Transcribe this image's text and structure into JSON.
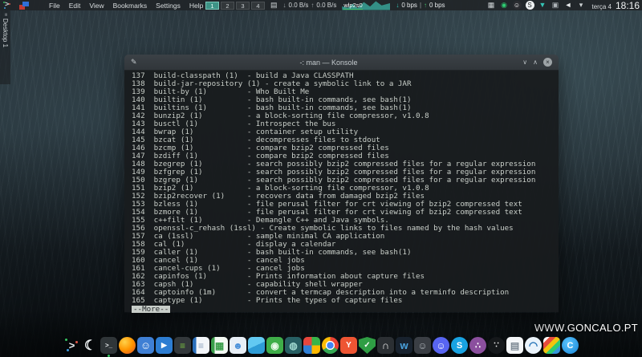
{
  "colors": {
    "panel_bg": "#212528",
    "accent_teal": "#35c4b5",
    "accent_green": "#46c06a",
    "terminal_bg": "#181b1d",
    "terminal_fg": "#c9cfc9",
    "titlebar_bg": "#343a3f",
    "workspace_active_bg": "#3d9386"
  },
  "top_bar": {
    "menus": [
      "File",
      "Edit",
      "View",
      "Bookmarks",
      "Settings",
      "Help"
    ],
    "workspaces": {
      "items": [
        "1",
        "2",
        "3",
        "4"
      ],
      "active": "1"
    },
    "icons": {
      "notes": "▤",
      "grip": "≡"
    },
    "net_speed": {
      "down_arrow": "↓",
      "down": "0.0 B/s",
      "up_arrow": "↑",
      "up": "0.0 B/s"
    },
    "interface": {
      "name": "wlp2s0",
      "down_arrow": "↓",
      "down": "0 bps",
      "separator": "|",
      "up_arrow": "↑",
      "up": "0 bps"
    },
    "tray": [
      {
        "name": "panel-tray-icon",
        "glyph": "▦",
        "fg": "#cfd4d6"
      },
      {
        "name": "status-green-tray-icon",
        "glyph": "◉",
        "fg": "#2ecc71"
      },
      {
        "name": "discord-tray-icon",
        "glyph": "☺",
        "fg": "#ffffff",
        "bg": "#2b2d31",
        "shape": "circle"
      },
      {
        "name": "skype-tray-icon",
        "glyph": "S",
        "fg": "#202325",
        "bg": "#eef1f2",
        "shape": "circle"
      },
      {
        "name": "vpn-tray-icon",
        "glyph": "▼",
        "fg": "#35c4b5"
      },
      {
        "name": "window-tray-icon",
        "glyph": "▣",
        "fg": "#aeb4b8"
      },
      {
        "name": "volume-tray-icon",
        "glyph": "◄",
        "fg": "#e8ebed"
      },
      {
        "name": "caret-down-icon",
        "glyph": "▾",
        "fg": "#cfd4d6"
      }
    ],
    "clock": {
      "date": "terça 4",
      "time": "18:16"
    }
  },
  "pager_label": "Desktop 1",
  "window": {
    "title": "-: man — Konsole",
    "icons": {
      "pin": "✎",
      "minimize": "∨",
      "maximize": "∧",
      "close": "×"
    },
    "terminal_lines": [
      "137  build-classpath (1)  - build a Java CLASSPATH",
      "138  build-jar-repository (1) - create a symbolic link to a JAR",
      "139  built-by (1)         - Who Built Me",
      "140  builtin (1)          - bash built-in commands, see bash(1)",
      "141  builtins (1)         - bash built-in commands, see bash(1)",
      "142  bunzip2 (1)          - a block-sorting file compressor, v1.0.8",
      "143  busctl (1)           - Introspect the bus",
      "144  bwrap (1)            - container setup utility",
      "145  bzcat (1)            - decompresses files to stdout",
      "146  bzcmp (1)            - compare bzip2 compressed files",
      "147  bzdiff (1)           - compare bzip2 compressed files",
      "148  bzegrep (1)          - search possibly bzip2 compressed files for a regular expression",
      "149  bzfgrep (1)          - search possibly bzip2 compressed files for a regular expression",
      "150  bzgrep (1)           - search possibly bzip2 compressed files for a regular expression",
      "151  bzip2 (1)            - a block-sorting file compressor, v1.0.8",
      "152  bzip2recover (1)     - recovers data from damaged bzip2 files",
      "153  bzless (1)           - file perusal filter for crt viewing of bzip2 compressed text",
      "154  bzmore (1)           - file perusal filter for crt viewing of bzip2 compressed text",
      "155  c++filt (1)          - Demangle C++ and Java symbols.",
      "156  openssl-c_rehash (1ssl) - Create symbolic links to files named by the hash values",
      "157  ca (1ssl)            - sample minimal CA application",
      "158  cal (1)              - display a calendar",
      "159  caller (1)           - bash built-in commands, see bash(1)",
      "160  cancel (1)           - cancel jobs",
      "161  cancel-cups (1)      - cancel jobs",
      "162  capinfos (1)         - Prints information about capture files",
      "163  capsh (1)            - capability shell wrapper",
      "164  captoinfo (1m)       - convert a termcap description into a terminfo description",
      "165  captype (1)          - Prints the types of capture files"
    ],
    "more_prompt": "--More--"
  },
  "watermark": "WWW.GONCALO.PT",
  "dock": {
    "items": [
      {
        "name": "distro-logo-icon",
        "type": "logo"
      },
      {
        "name": "night-mode-icon",
        "glyph": "☾",
        "fg": "#eef2f4",
        "size": 17
      },
      {
        "name": "terminal-icon",
        "glyph": ">_",
        "fg": "#e0e4e6",
        "bg": "#2f3538",
        "size": 8,
        "running": true
      },
      {
        "name": "firefox-icon",
        "bg": "radial-gradient(circle at 35% 30%, #ffd24a, #ff9500 50%, #e5621f 85%)",
        "shape": "circle"
      },
      {
        "name": "messenger-icon",
        "glyph": "☺",
        "fg": "#ffffff",
        "bg": "#3f7fd4",
        "size": 13
      },
      {
        "name": "media-player-icon",
        "glyph": "▶",
        "fg": "#ffffff",
        "bg": "#2d7dd2",
        "size": 9
      },
      {
        "name": "recorder-icon",
        "glyph": "≡",
        "fg": "#7bc143",
        "bg": "#33383b",
        "size": 12
      },
      {
        "name": "writer-doc-icon",
        "glyph": "≡",
        "fg": "#8fa3bd",
        "bg": "linear-gradient(90deg, #2a6fbb 0 22%, #f3f6fa 22%)",
        "size": 12
      },
      {
        "name": "spreadsheet-icon",
        "glyph": "▦",
        "fg": "#3a9e4a",
        "bg": "linear-gradient(90deg, #3a9e4a 0 22%, #f4faf4 22%)",
        "size": 12
      },
      {
        "name": "stamp-icon",
        "glyph": "☻",
        "fg": "#4a90d9",
        "bg": "#e8eff6",
        "size": 12
      },
      {
        "name": "package-cube-icon",
        "bg": "linear-gradient(155deg, #62c9f2 50%, #2e9cd6 50%)"
      },
      {
        "name": "camera-icon",
        "glyph": "◉",
        "fg": "#eafaea",
        "bg": "#3fae49",
        "size": 12
      },
      {
        "name": "octopus-icon",
        "glyph": "◍",
        "fg": "#9fd8cf",
        "bg": "#275f63",
        "size": 12
      },
      {
        "name": "office-grid-icon",
        "bg": "conic-gradient(#38b44a 0 25%, #fdb900 0 50%, #2f7fd6 0 75%, #e8463c 0)"
      },
      {
        "name": "chrome-icon",
        "bg": "radial-gradient(circle, #4285f4 0 28%, #ffffff 29% 37%, rgba(0,0,0,0) 38%), conic-gradient(#ea4335 0 33%, #34a853 0 66%, #fbbc05 0)",
        "shape": "circle"
      },
      {
        "name": "git-icon",
        "glyph": "Y",
        "fg": "#ffffff",
        "bg": "#ee5533",
        "size": 10
      },
      {
        "name": "keepass-icon",
        "glyph": "✓",
        "fg": "#ffffff",
        "bg": "#2f9e44",
        "shape": "shield",
        "size": 10
      },
      {
        "name": "headphones-icon",
        "glyph": "∩",
        "fg": "#e8e8e8",
        "bg": "#2b2f33",
        "size": 13
      },
      {
        "name": "wave-icon",
        "glyph": "w",
        "fg": "#4aa3df",
        "bg": "#18222e",
        "size": 13
      },
      {
        "name": "discord-alt-icon",
        "glyph": "☺",
        "fg": "#b0b6bc",
        "bg": "#3a3e44",
        "size": 12
      },
      {
        "name": "discord-icon",
        "glyph": "☺",
        "fg": "#ffffff",
        "bg": "#5865f2",
        "shape": "circle",
        "size": 12
      },
      {
        "name": "skype-icon",
        "glyph": "S",
        "fg": "#ffffff",
        "bg": "#18a3e2",
        "shape": "circle",
        "size": 11
      },
      {
        "name": "paw-icon",
        "glyph": "∴",
        "fg": "#ffffff",
        "bg": "#8b4f9e",
        "shape": "circle",
        "size": 11
      },
      {
        "name": "obs-icon",
        "glyph": "∵",
        "fg": "#f2f2f2",
        "bg": "#15181b",
        "shape": "circle",
        "size": 10
      },
      {
        "name": "contacts-icon",
        "glyph": "▤",
        "fg": "#7c8893",
        "bg": "#f5f7f9",
        "size": 12
      },
      {
        "name": "wireshark-icon",
        "glyph": "◠",
        "fg": "#1f6fb5",
        "bg": "#eaf3fb",
        "shape": "circle",
        "size": 13
      },
      {
        "name": "chart-icon",
        "bg": "linear-gradient(135deg, #ffffff 0 18%, #e74c3c 18% 38%, #f1c40f 38% 56%, #2ecc71 56% 74%, #3498db 74%)"
      },
      {
        "name": "bittorrent-icon",
        "glyph": "C",
        "fg": "#ffffff",
        "bg": "radial-gradient(circle at 40% 35%, #5cc6ff, #1583d6)",
        "shape": "circle",
        "size": 11
      }
    ]
  }
}
